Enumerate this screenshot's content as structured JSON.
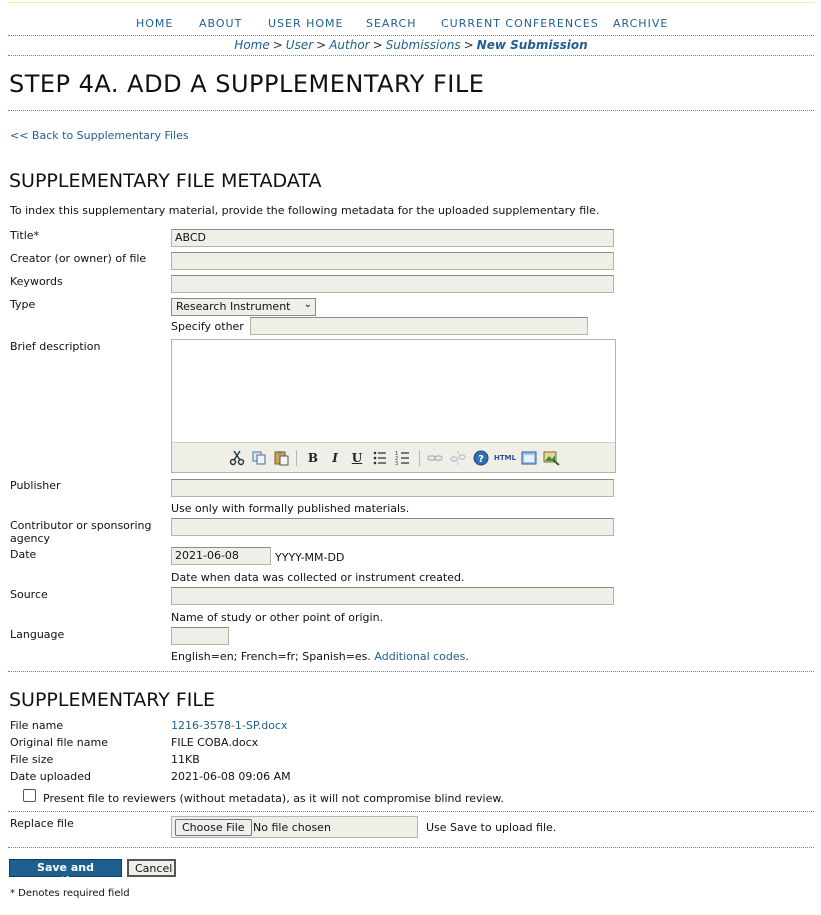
{
  "nav": {
    "home": "HOME",
    "about": "ABOUT",
    "user_home": "USER HOME",
    "search": "SEARCH",
    "current_conferences": "CURRENT CONFERENCES",
    "archive": "ARCHIVE"
  },
  "breadcrumb": {
    "home": "Home",
    "user": "User",
    "author": "Author",
    "submissions": "Submissions",
    "current": "New Submission",
    "separator": ">"
  },
  "page_title": "STEP 4A. ADD A SUPPLEMENTARY FILE",
  "back_link": "<< Back to Supplementary Files",
  "metadata": {
    "heading": "SUPPLEMENTARY FILE METADATA",
    "intro": "To index this supplementary material, provide the following metadata for the uploaded supplementary file.",
    "title_label": "Title*",
    "title_value": "ABCD",
    "creator_label": "Creator (or owner) of file",
    "creator_value": "",
    "keywords_label": "Keywords",
    "keywords_value": "",
    "type_label": "Type",
    "type_selected": "Research Instrument",
    "specify_other_label": "Specify other",
    "specify_other_value": "",
    "description_label": "Brief description",
    "publisher_label": "Publisher",
    "publisher_value": "",
    "publisher_hint": "Use only with formally published materials.",
    "contributor_label": "Contributor or sponsoring agency",
    "contributor_value": "",
    "date_label": "Date",
    "date_value": "2021-06-08",
    "date_format": "YYYY-MM-DD",
    "date_hint": "Date when data was collected or instrument created.",
    "source_label": "Source",
    "source_value": "",
    "source_hint": "Name of study or other point of origin.",
    "language_label": "Language",
    "language_value": "",
    "language_hint": "English=en; French=fr; Spanish=es.",
    "language_codes_link": "Additional codes",
    "language_hint_end": "."
  },
  "editor_toolbar": {
    "cut": "cut-icon",
    "copy": "copy-icon",
    "paste": "paste-icon",
    "bold": "B",
    "italic": "I",
    "underline": "U",
    "bullets": "bullet-list-icon",
    "numbers": "numbered-list-icon",
    "link": "link-icon",
    "unlink": "unlink-icon",
    "help": "help-icon",
    "html": "HTML",
    "fullscreen": "fullscreen-icon",
    "image": "insert-image-icon"
  },
  "supplementary_file": {
    "heading": "SUPPLEMENTARY FILE",
    "file_name_label": "File name",
    "file_name_value": "1216-3578-1-SP.docx",
    "original_name_label": "Original file name",
    "original_name_value": "FILE COBA.docx",
    "file_size_label": "File size",
    "file_size_value": "11KB",
    "date_uploaded_label": "Date uploaded",
    "date_uploaded_value": "2021-06-08 09:06 AM",
    "present_to_reviewers_label": "Present file to reviewers (without metadata), as it will not compromise blind review.",
    "present_to_reviewers_checked": false,
    "replace_label": "Replace file",
    "choose_file_button": "Choose File",
    "no_file_chosen": "No file chosen",
    "upload_hint": "Use Save to upload file."
  },
  "buttons": {
    "save": "Save and continue",
    "cancel": "Cancel"
  },
  "required_note": "* Denotes required field",
  "colors": {
    "link": "#1f5f8f",
    "rule": "#4d90ad",
    "field_bg": "#f0efe7",
    "save_bg": "#1f5f8f"
  }
}
